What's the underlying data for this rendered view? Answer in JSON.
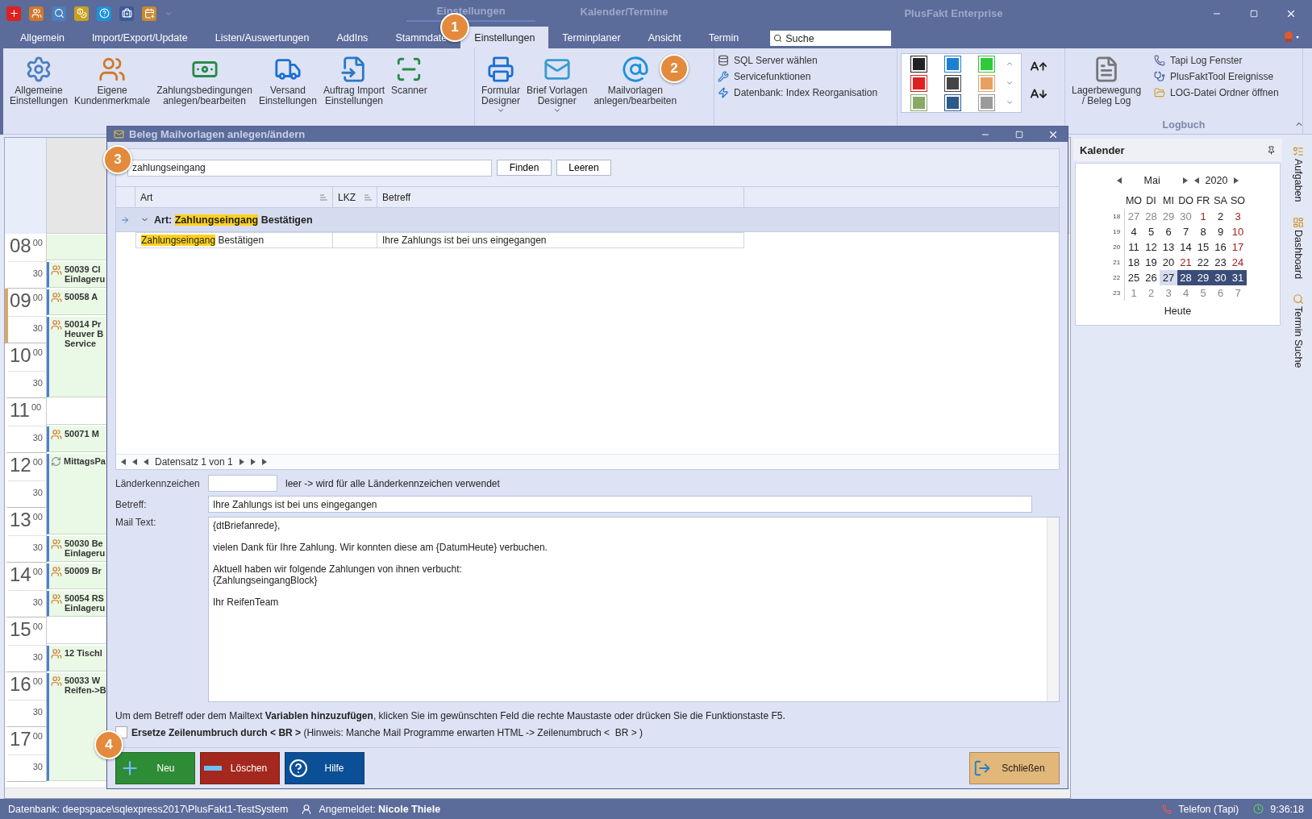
{
  "window": {
    "context_titles": [
      "Einstellungen",
      "Kalender/Termine"
    ],
    "title": "PlusFakt Enterprise"
  },
  "tabs": [
    {
      "label": "Allgemein",
      "selected": false
    },
    {
      "label": "Import/Export/Update",
      "selected": false
    },
    {
      "label": "Listen/Auswertungen",
      "selected": false
    },
    {
      "label": "AddIns",
      "selected": false
    },
    {
      "label": "Stammdate",
      "selected": false
    },
    {
      "label": "Einstellungen",
      "selected": true
    },
    {
      "label": "Terminplaner",
      "selected": false
    },
    {
      "label": "Ansicht",
      "selected": false
    },
    {
      "label": "Termin",
      "selected": false
    }
  ],
  "search": {
    "placeholder": "Suche"
  },
  "ribbon": {
    "groups": [
      {
        "kind": "large",
        "items": [
          {
            "lines": [
              "Allgemeine",
              "Einstellungen"
            ],
            "dropdown": false
          },
          {
            "lines": [
              "Eigene",
              "Kundenmerkmale"
            ],
            "dropdown": false
          },
          {
            "lines": [
              "Zahlungsbedingungen",
              "anlegen/bearbeiten"
            ],
            "dropdown": false
          },
          {
            "lines": [
              "Versand",
              "Einstellungen"
            ],
            "dropdown": false
          },
          {
            "lines": [
              "Auftrag Import",
              "Einstellungen"
            ],
            "dropdown": false
          },
          {
            "lines": [
              "Scanner"
            ],
            "dropdown": false
          }
        ]
      },
      {
        "kind": "large",
        "items": [
          {
            "lines": [
              "Formular",
              "Designer"
            ],
            "dropdown": true
          },
          {
            "lines": [
              "Brief Vorlagen",
              "Designer"
            ],
            "dropdown": true
          },
          {
            "lines": [
              "Mailvorlagen",
              "anlegen/bearbeiten"
            ],
            "dropdown": false
          }
        ]
      },
      {
        "kind": "small",
        "items": [
          {
            "label": "SQL Server wählen"
          },
          {
            "label": "Servicefunktionen"
          },
          {
            "label": "Datenbank: Index Reorganisation"
          }
        ]
      },
      {
        "kind": "gallery",
        "swatches": [
          {
            "color": "#222222"
          },
          {
            "color": "#1e7fd0"
          },
          {
            "color": "#2fc93a"
          },
          {
            "color": "#e02020"
          },
          {
            "color": "#444444"
          },
          {
            "color": "#e8a060"
          },
          {
            "color": "#8aa868"
          },
          {
            "color": "#2a5a8a"
          },
          {
            "color": "#9a9a9a"
          }
        ]
      },
      {
        "kind": "mixed",
        "caption": "Logbuch",
        "large": {
          "lines": [
            "Lagerbewegung",
            "/ Beleg Log"
          ],
          "dropdown": false
        },
        "items": [
          {
            "label": "Tapi Log Fenster"
          },
          {
            "label": "PlusFaktTool Ereignisse"
          },
          {
            "label": "LOG-Datei Ordner öffnen"
          }
        ]
      }
    ]
  },
  "scheduler": {
    "hours": [
      {
        "hour": "08",
        "minutes": [
          "00",
          "30"
        ],
        "marked": false
      },
      {
        "hour": "09",
        "minutes": [
          "00",
          "30"
        ],
        "marked": true
      },
      {
        "hour": "10",
        "minutes": [
          "00",
          "30"
        ],
        "marked": false
      },
      {
        "hour": "11",
        "minutes": [
          "00",
          "30"
        ],
        "marked": false
      },
      {
        "hour": "12",
        "minutes": [
          "00",
          "30"
        ],
        "marked": false
      },
      {
        "hour": "13",
        "minutes": [
          "00",
          "30"
        ],
        "marked": false
      },
      {
        "hour": "14",
        "minutes": [
          "00",
          "30"
        ],
        "marked": false
      },
      {
        "hour": "15",
        "minutes": [
          "00",
          "30"
        ],
        "marked": false
      },
      {
        "hour": "16",
        "minutes": [
          "00",
          "30"
        ],
        "marked": false
      },
      {
        "hour": "17",
        "minutes": [
          "00",
          "30"
        ],
        "marked": false
      }
    ],
    "slots": [
      {
        "kind": "band"
      },
      {
        "kind": "appointment",
        "lines": [
          "50039 Cl",
          "Einlageru"
        ]
      },
      {
        "kind": "appointment",
        "lines": [
          "50058 A"
        ]
      },
      {
        "kind": "appointment",
        "lines": [
          "50014 Pr",
          "Heuver B",
          "Service"
        ]
      },
      {
        "kind": "empty"
      },
      {
        "kind": "appointment",
        "lines": [
          "50071 M"
        ]
      },
      {
        "kind": "recurring",
        "lines": [
          "MittagsPa"
        ]
      },
      {
        "kind": "appointment",
        "lines": [
          "50030 Be",
          "Einlageru"
        ]
      },
      {
        "kind": "appointment",
        "lines": [
          "50009 Br"
        ]
      },
      {
        "kind": "appointment",
        "lines": [
          "50054 RS",
          "Einlageru"
        ]
      },
      {
        "kind": "empty"
      },
      {
        "kind": "appointment",
        "lines": [
          "12 Tischl"
        ]
      },
      {
        "kind": "appointment",
        "lines": [
          "50033 W",
          "Reifen->B"
        ]
      }
    ]
  },
  "dialog": {
    "title": "Beleg Mailvorlagen anlegen/ändern",
    "search_value": "zahlungseingang",
    "search_buttons": [
      "Finden",
      "Leeren"
    ],
    "columns": [
      "Art",
      "LKZ",
      "Betreff"
    ],
    "group": {
      "expanded": true,
      "parts": [
        {
          "text": "Art:",
          "highlight": false
        },
        {
          "text": "Zahlungseingang",
          "highlight": true
        },
        {
          "text": "Bestätigen",
          "highlight": false
        }
      ]
    },
    "rows": [
      {
        "art": [
          {
            "text": "Zahlungseingang",
            "highlight": true
          },
          {
            "text": "Bestätigen",
            "highlight": false
          }
        ],
        "betreff": "Ihre Zahlungs ist bei uns eingegangen"
      }
    ],
    "navigator": "Datensatz 1 von 1",
    "country_label": "Länderkennzeichen",
    "country_hint": "leer -> wird für alle Länderkennzeichen verwendet",
    "subject_label": "Betreff:",
    "subject_value": "Ihre Zahlungs ist bei uns eingegangen",
    "mail_label": "Mail Text:",
    "mail_value": "{dtBriefanrede},\n\nvielen Dank für Ihre Zahlung. Wir konnten diese am {DatumHeute} verbuchen.\n\nAktuell haben wir folgende Zahlungen von ihnen verbucht:\n{ZahlungseingangBlock}\n\nIhr ReifenTeam",
    "hint": "Um dem Betreff oder dem Mailtext **Variablen hinzuzufügen**, klicken Sie im gewünschten Feld die rechte Maustaste oder drücken Sie die Funktionstaste F5.",
    "replace_br": {
      "checked": false,
      "label": "**Ersetze Zeilenumbruch durch < BR >** (Hinweis: Manche Mail Programme erwarten HTML -> Zeilenumbruch <  BR > )"
    },
    "buttons": [
      {
        "kind": "add",
        "label": "Neu",
        "color": "#2e8b36"
      },
      {
        "kind": "delete",
        "label": "Löschen",
        "color": "#a4281e"
      },
      {
        "kind": "help",
        "label": "Hilfe",
        "color": "#0b4f96"
      }
    ],
    "close_button": {
      "label": "Schließen",
      "color": "#e2b77a"
    }
  },
  "calendar": {
    "title": "Kalender",
    "month": "Mai",
    "year": "2020",
    "weekdays": [
      "MO",
      "DI",
      "MI",
      "DO",
      "FR",
      "SA",
      "SO"
    ],
    "today_label": "Heute",
    "weeks": [
      {
        "week": "18",
        "days": [
          {
            "d": "27",
            "kind": "other",
            "selected": false,
            "today": false
          },
          {
            "d": "28",
            "kind": "other",
            "selected": false,
            "today": false
          },
          {
            "d": "29",
            "kind": "other",
            "selected": false,
            "today": false
          },
          {
            "d": "30",
            "kind": "other",
            "selected": false,
            "today": false
          },
          {
            "d": "1",
            "kind": "red",
            "selected": false,
            "today": false
          },
          {
            "d": "2",
            "kind": "normal",
            "selected": false,
            "today": false
          },
          {
            "d": "3",
            "kind": "red",
            "selected": false,
            "today": false
          }
        ]
      },
      {
        "week": "19",
        "days": [
          {
            "d": "4",
            "kind": "normal",
            "selected": false,
            "today": false
          },
          {
            "d": "5",
            "kind": "normal",
            "selected": false,
            "today": false
          },
          {
            "d": "6",
            "kind": "normal",
            "selected": false,
            "today": false
          },
          {
            "d": "7",
            "kind": "normal",
            "selected": false,
            "today": false
          },
          {
            "d": "8",
            "kind": "normal",
            "selected": false,
            "today": false
          },
          {
            "d": "9",
            "kind": "normal",
            "selected": false,
            "today": false
          },
          {
            "d": "10",
            "kind": "red",
            "selected": false,
            "today": false
          }
        ]
      },
      {
        "week": "20",
        "days": [
          {
            "d": "11",
            "kind": "normal",
            "selected": false,
            "today": false
          },
          {
            "d": "12",
            "kind": "normal",
            "selected": false,
            "today": false
          },
          {
            "d": "13",
            "kind": "normal",
            "selected": false,
            "today": false
          },
          {
            "d": "14",
            "kind": "normal",
            "selected": false,
            "today": false
          },
          {
            "d": "15",
            "kind": "normal",
            "selected": false,
            "today": false
          },
          {
            "d": "16",
            "kind": "normal",
            "selected": false,
            "today": false
          },
          {
            "d": "17",
            "kind": "red",
            "selected": false,
            "today": false
          }
        ]
      },
      {
        "week": "21",
        "days": [
          {
            "d": "18",
            "kind": "normal",
            "selected": false,
            "today": false
          },
          {
            "d": "19",
            "kind": "normal",
            "selected": false,
            "today": false
          },
          {
            "d": "20",
            "kind": "normal",
            "selected": false,
            "today": false
          },
          {
            "d": "21",
            "kind": "red",
            "selected": false,
            "today": false
          },
          {
            "d": "22",
            "kind": "normal",
            "selected": false,
            "today": false
          },
          {
            "d": "23",
            "kind": "normal",
            "selected": false,
            "today": false
          },
          {
            "d": "24",
            "kind": "red",
            "selected": false,
            "today": false
          }
        ]
      },
      {
        "week": "22",
        "days": [
          {
            "d": "25",
            "kind": "normal",
            "selected": false,
            "today": false
          },
          {
            "d": "26",
            "kind": "normal",
            "selected": false,
            "today": false
          },
          {
            "d": "27",
            "kind": "normal",
            "selected": false,
            "today": true
          },
          {
            "d": "28",
            "kind": "normal",
            "selected": true,
            "today": false
          },
          {
            "d": "29",
            "kind": "normal",
            "selected": true,
            "today": false
          },
          {
            "d": "30",
            "kind": "normal",
            "selected": true,
            "today": false
          },
          {
            "d": "31",
            "kind": "normal",
            "selected": true,
            "today": false
          }
        ]
      },
      {
        "week": "23",
        "days": [
          {
            "d": "1",
            "kind": "other",
            "selected": false,
            "today": false
          },
          {
            "d": "2",
            "kind": "other",
            "selected": false,
            "today": false
          },
          {
            "d": "3",
            "kind": "other",
            "selected": false,
            "today": false
          },
          {
            "d": "4",
            "kind": "other",
            "selected": false,
            "today": false
          },
          {
            "d": "5",
            "kind": "other",
            "selected": false,
            "today": false
          },
          {
            "d": "6",
            "kind": "other",
            "selected": false,
            "today": false
          },
          {
            "d": "7",
            "kind": "other",
            "selected": false,
            "today": false
          }
        ]
      }
    ]
  },
  "side_tabs": [
    {
      "kind": "tasks",
      "label": "Aufgaben"
    },
    {
      "kind": "dashboard",
      "label": "Dashboard"
    },
    {
      "kind": "search",
      "label": "Termin Suche"
    }
  ],
  "badges": [
    "1",
    "2",
    "3",
    "4"
  ],
  "status_bar": {
    "database": "Datenbank: deepspace\\sqlexpress2017\\PlusFakt1-TestSystem",
    "user": "Angemeldet: **Nicole Thiele**",
    "phone": "Telefon (Tapi)",
    "time": "9:36:18"
  }
}
